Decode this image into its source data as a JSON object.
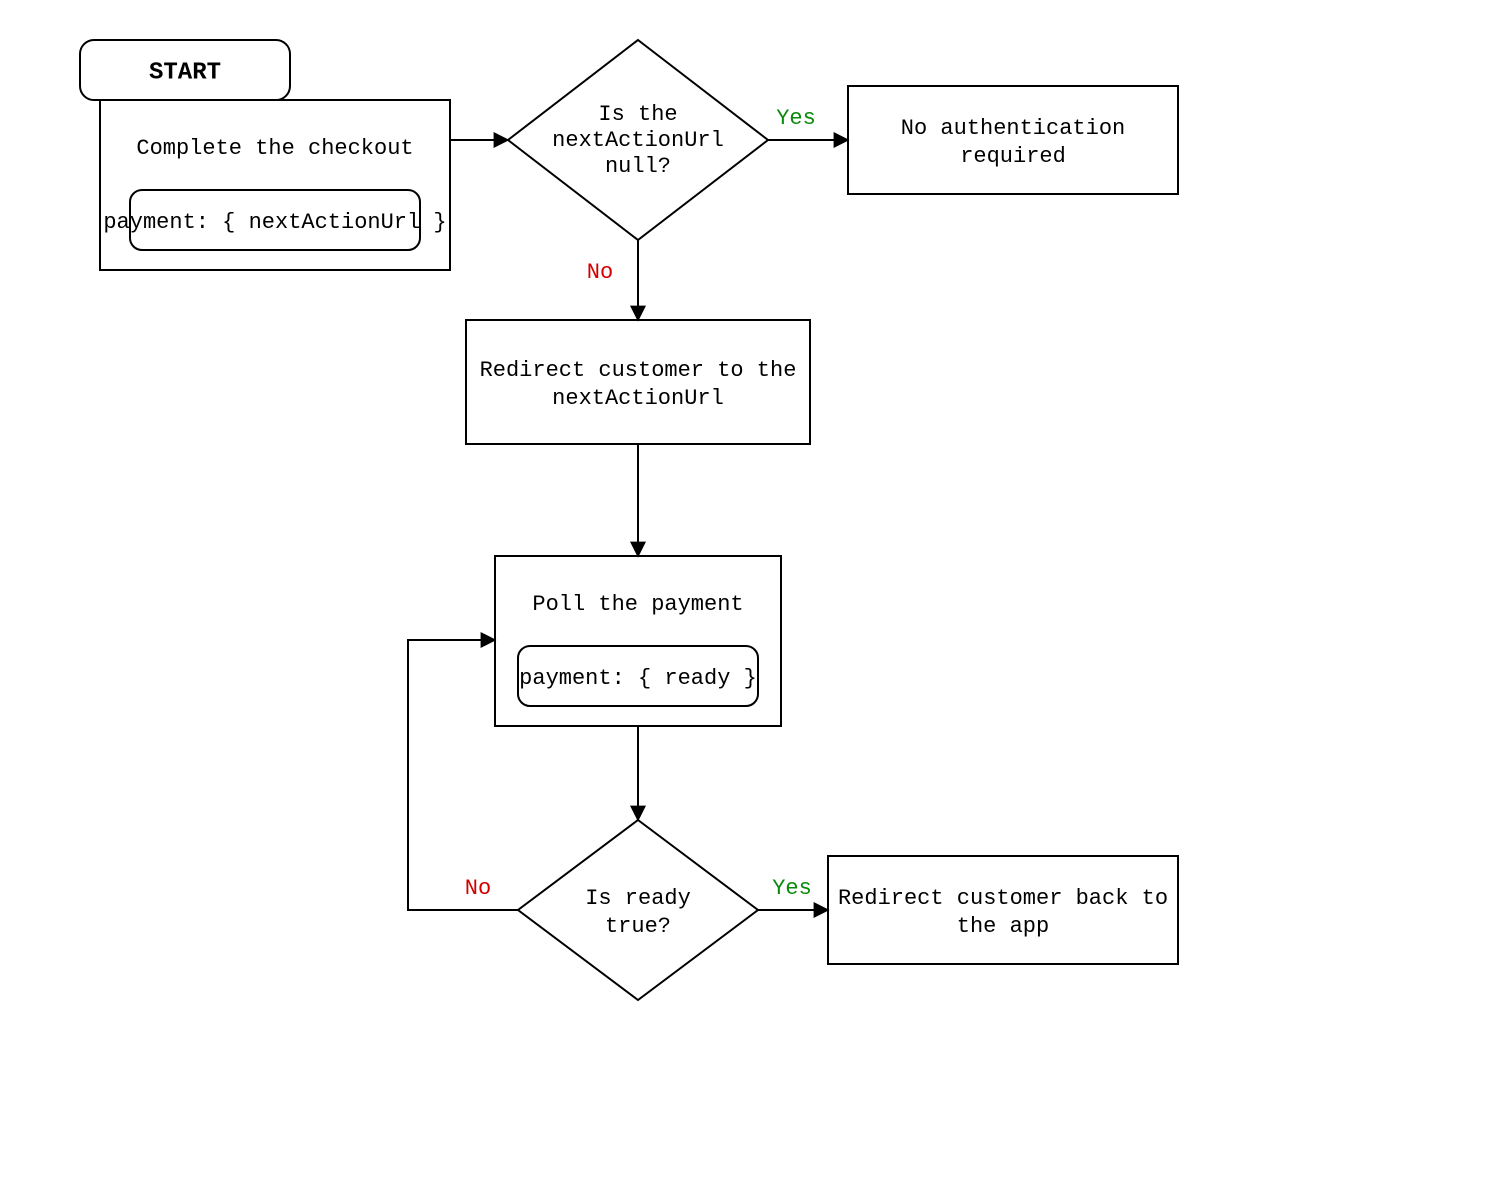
{
  "nodes": {
    "start": {
      "label": "START"
    },
    "complete": {
      "label": "Complete the checkout"
    },
    "complete_sub": {
      "label": "payment: { nextActionUrl }"
    },
    "decision1": {
      "line1": "Is the",
      "line2": "nextActionUrl",
      "line3": "null?"
    },
    "noauth": {
      "line1": "No authentication",
      "line2": "required"
    },
    "redirect1": {
      "line1": "Redirect customer to the",
      "line2": "nextActionUrl"
    },
    "poll": {
      "label": "Poll the payment"
    },
    "poll_sub": {
      "label": "payment: { ready }"
    },
    "decision2": {
      "line1": "Is ready",
      "line2": "true?"
    },
    "redirect2": {
      "line1": "Redirect customer back to",
      "line2": "the app"
    }
  },
  "edges": {
    "yes": "Yes",
    "no": "No"
  },
  "colors": {
    "stroke": "#000000",
    "yes": "#0a8a0a",
    "no": "#d40000"
  }
}
